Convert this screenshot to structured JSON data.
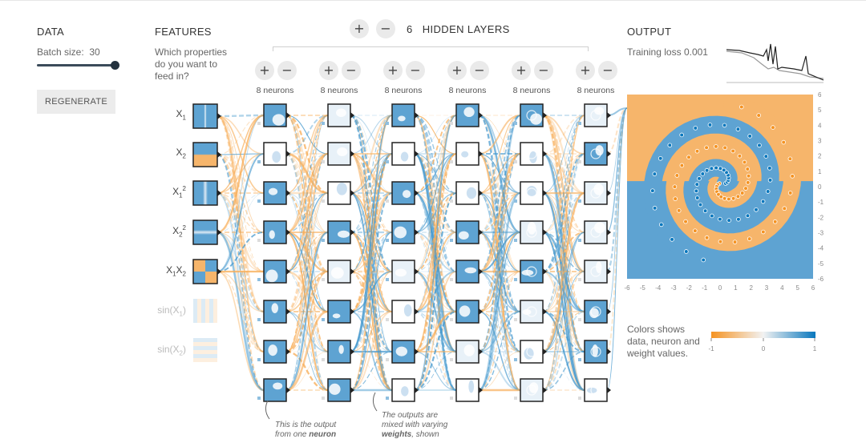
{
  "data_panel": {
    "title": "DATA",
    "batch_size_label": "Batch size:",
    "batch_size_value": "30",
    "batch_size_fraction": 1.0,
    "regenerate_label": "REGENERATE"
  },
  "features_panel": {
    "title": "FEATURES",
    "question_lines": [
      "Which properties",
      "do you want to",
      "feed in?"
    ],
    "features": [
      {
        "id": "x1",
        "active": true,
        "pattern": "vsplit"
      },
      {
        "id": "x2",
        "active": true,
        "pattern": "hsplit"
      },
      {
        "id": "x1sq",
        "active": true,
        "pattern": "vband"
      },
      {
        "id": "x2sq",
        "active": true,
        "pattern": "hband"
      },
      {
        "id": "x1x2",
        "active": true,
        "pattern": "quad"
      },
      {
        "id": "sinx1",
        "active": false,
        "pattern": "vstripes"
      },
      {
        "id": "sinx2",
        "active": false,
        "pattern": "hstripes"
      }
    ]
  },
  "hidden_layers": {
    "count": "6",
    "label": "HIDDEN LAYERS",
    "add_symbol": "+",
    "remove_symbol": "−",
    "layers": [
      {
        "neurons_label": "8 neurons"
      },
      {
        "neurons_label": "8 neurons"
      },
      {
        "neurons_label": "8 neurons"
      },
      {
        "neurons_label": "8 neurons"
      },
      {
        "neurons_label": "8 neurons"
      },
      {
        "neurons_label": "8 neurons"
      }
    ]
  },
  "annotations": {
    "neuron_note": [
      "This is the output",
      "from one",
      "neuron"
    ],
    "weights_note": [
      "The outputs are",
      "mixed with varying",
      "weights",
      ", shown"
    ]
  },
  "output_panel": {
    "title": "OUTPUT",
    "training_loss_label": "Training loss",
    "training_loss_value": "0.001",
    "axis_ticks": [
      "-6",
      "-5",
      "-4",
      "-3",
      "-2",
      "-1",
      "0",
      "1",
      "2",
      "3",
      "4",
      "5",
      "6"
    ],
    "legend_text": [
      "Colors shows",
      "data, neuron and",
      "weight values."
    ],
    "legend_ticks": [
      "-1",
      "0",
      "1"
    ],
    "colors": {
      "positive": "#0877bd",
      "negative": "#f59322",
      "light_blue": "#5ea3d2",
      "light_orange": "#f6b56b"
    }
  }
}
